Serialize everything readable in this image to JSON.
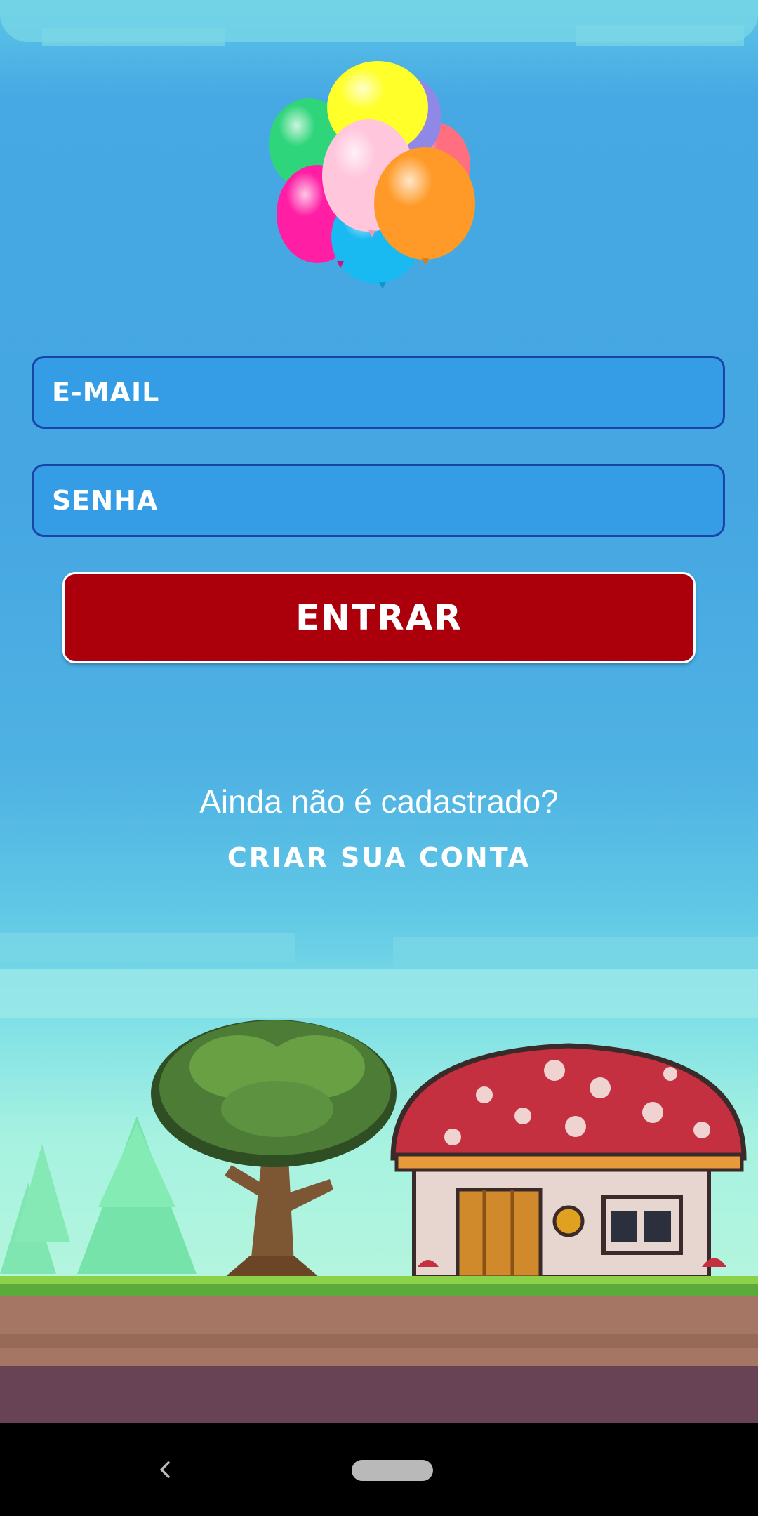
{
  "login": {
    "email_placeholder": "E-MAIL",
    "password_placeholder": "SENHA",
    "submit_label": "ENTRAR"
  },
  "signup": {
    "question": "Ainda não é cadastrado?",
    "link_label": "CRIAR SUA CONTA"
  },
  "colors": {
    "field_fill": "#359ce6",
    "field_border": "#1846a8",
    "button_fill": "#ab000b"
  },
  "icons": [
    "balloons-logo",
    "back-icon",
    "home-pill"
  ]
}
